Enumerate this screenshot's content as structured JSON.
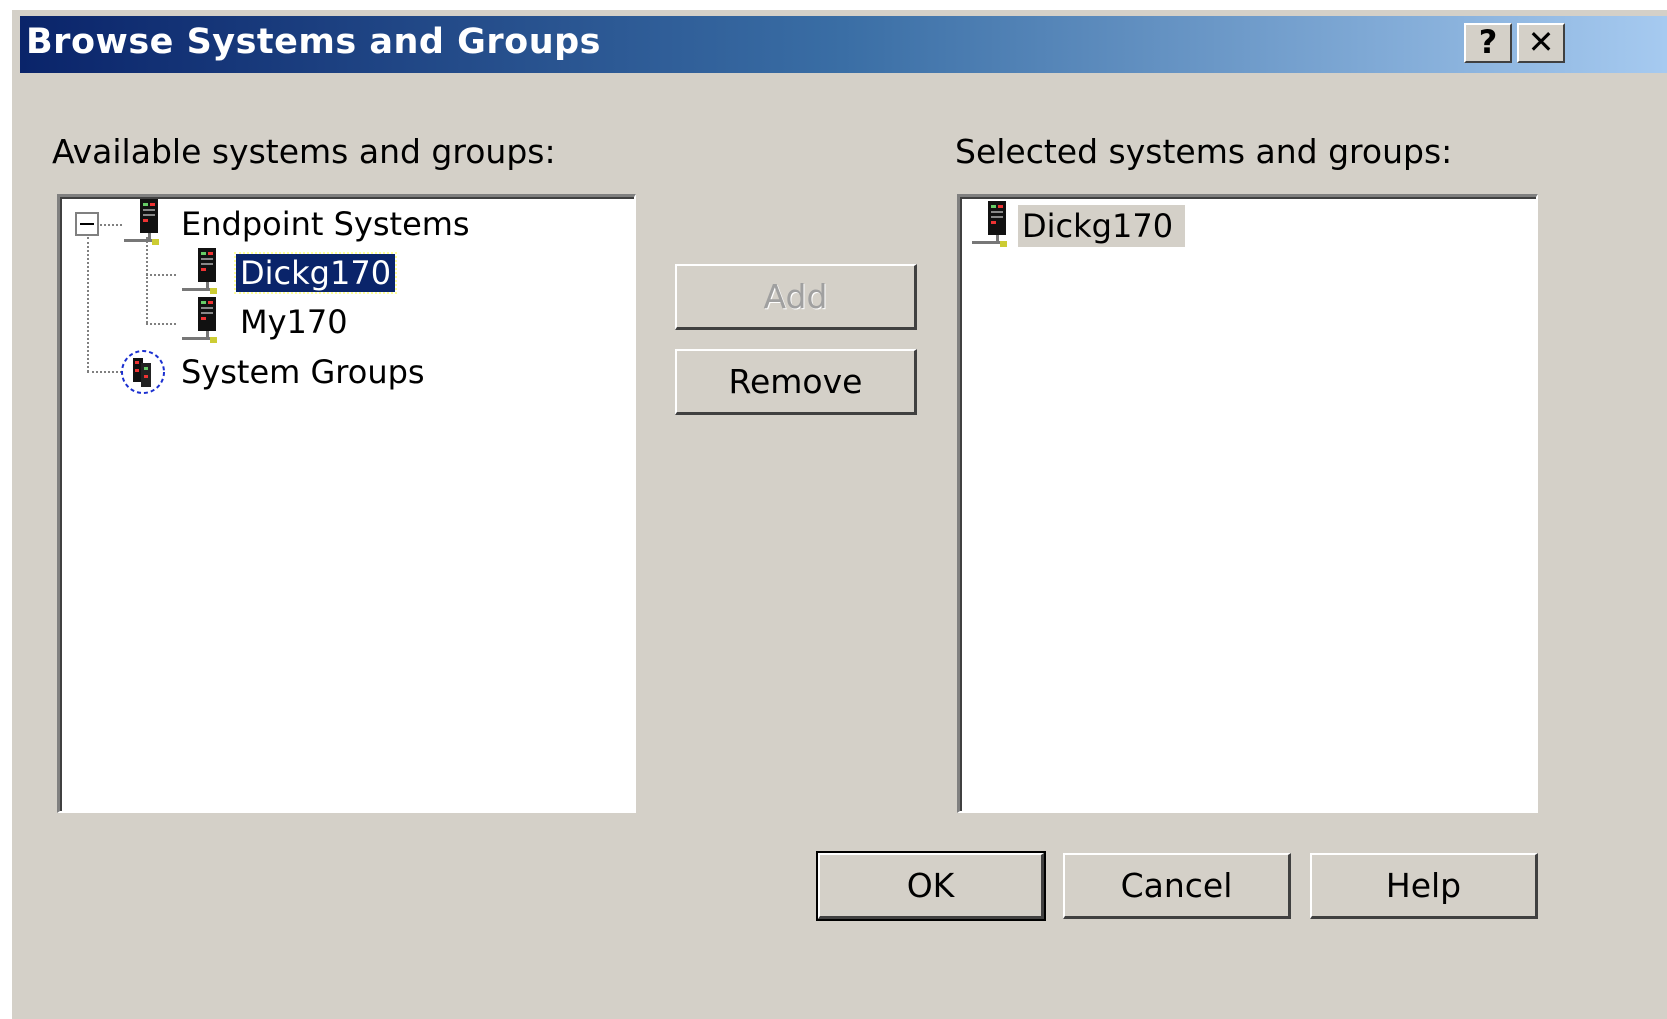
{
  "window": {
    "title": "Browse Systems and Groups",
    "help_button": "?",
    "close_button": "✕"
  },
  "available": {
    "label": "Available systems and groups:",
    "tree": [
      {
        "label": "Endpoint Systems",
        "icon": "server-icon",
        "expanded": true,
        "children": [
          {
            "label": "Dickg170",
            "icon": "server-icon",
            "selected": true
          },
          {
            "label": "My170",
            "icon": "server-icon"
          }
        ]
      },
      {
        "label": "System Groups",
        "icon": "system-group-icon"
      }
    ]
  },
  "selected": {
    "label": "Selected systems and groups:",
    "items": [
      {
        "label": "Dickg170",
        "icon": "server-icon"
      }
    ]
  },
  "buttons": {
    "add": "Add",
    "remove": "Remove",
    "ok": "OK",
    "cancel": "Cancel",
    "help": "Help"
  },
  "colors": {
    "title_start": "#0a246a",
    "title_end": "#a6caf0",
    "selection": "#0a246a",
    "face": "#d4d0c8"
  }
}
